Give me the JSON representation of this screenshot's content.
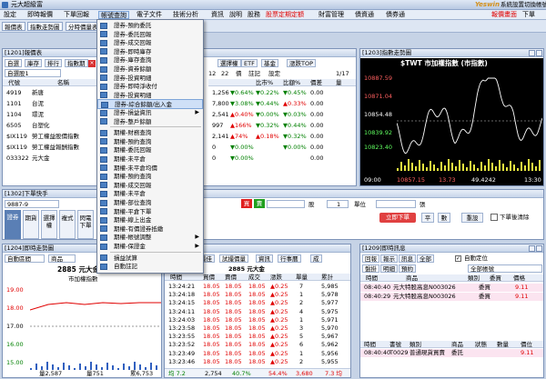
{
  "app": {
    "title": "元大超級富",
    "brand": "Yeswin",
    "sys_settings": "系統設置",
    "switch_account": "切換帳號",
    "right_buttons": [
      "報價畫面",
      "下單"
    ]
  },
  "menu": [
    "設定",
    "即時報價",
    "下單回報",
    "帳號查詢",
    "電子文件",
    "技術分析",
    "資訊",
    "說明",
    "股務",
    "股票定期定額",
    "財富管理",
    "債資通",
    "債券通"
  ],
  "toolbar": [
    "報價表",
    "指數走勢圖",
    "分時價量表"
  ],
  "quote_panel": {
    "title": "[1201]報價表",
    "tabs": [
      "自選",
      "庫存",
      "排行",
      "指數期",
      "個"
    ],
    "group_label": "自選股1",
    "col_code": "代號",
    "col_name": "名稱",
    "rows": [
      {
        "code": "4919",
        "name": "新唐"
      },
      {
        "code": "1101",
        "name": "台泥"
      },
      {
        "code": "1104",
        "name": "環泥"
      },
      {
        "code": "6505",
        "name": "台塑化"
      },
      {
        "code": "$IX119",
        "name": "勞工權益股價指數"
      },
      {
        "code": "$IX119",
        "name": "勞工權益報酬指數"
      },
      {
        "code": "033322",
        "name": "元大金"
      }
    ]
  },
  "quote_right": {
    "tabs": [
      "選擇權",
      "ETF",
      "基金",
      "漲跌TOP"
    ],
    "small_tabs": [
      "12",
      "22",
      "債",
      "註記",
      "設定"
    ],
    "page": "1/17",
    "headers": [
      "比市%",
      "比額%",
      "價差",
      "量"
    ],
    "rows": [
      {
        "v1": "1,256",
        "c1": "▼0.64%",
        "c2": "▼0.22%",
        "c3": "▼0.45%",
        "c4": "0.00"
      },
      {
        "v1": "7,800",
        "c1": "▼3.08%",
        "c2": "▼0.44%",
        "c3": "▲0.33%",
        "c4": "0.00"
      },
      {
        "v1": "2,541",
        "c1": "▲0.40%",
        "c2": "▼0.00%",
        "c3": "▼0.03%",
        "c4": "0.00"
      },
      {
        "v1": "997",
        "c1": "▲166%",
        "c2": "▼0.32%",
        "c3": "▼0.44%",
        "c4": "0.00"
      },
      {
        "v1": "2,141",
        "c1": "▲74%",
        "c2": "▲0.18%",
        "c3": "▼0.32%",
        "c4": "0.00"
      },
      {
        "v1": "0",
        "c1": "▼0.00%",
        "c2": "",
        "c3": "▼0.00%",
        "c4": "0.00"
      },
      {
        "v1": "0",
        "c1": "▼0.00%",
        "c2": "",
        "c3": "",
        "c4": "0.00"
      }
    ]
  },
  "dropdown": {
    "items": [
      "證券-預約委託",
      "證券-委託回報",
      "證券-成交回報",
      "證券-即時庫存",
      "證券-庫存查詢",
      "證券-資券餘額",
      "證券-投資明細",
      "證券-即時淨收付",
      "證券-投資明細",
      "證券-綜合餘額/出入金",
      "證券-損益資訊",
      "證券-整戶餘額",
      "期權-財務查詢",
      "期權-預約查詢",
      "期權-委託回報",
      "期權-未平倉",
      "期權-未平倉均價",
      "期權-預約查詢",
      "期權-成交回報",
      "期權-未平倉",
      "期權-部位查詢",
      "期權-平倉下單",
      "期權-線上出金",
      "期權-有價證券抵繳",
      "期權-帳號調整",
      "期權-保證金",
      "損益試算",
      "自動註記"
    ],
    "selected_index": 9,
    "has_submenu": [
      10,
      24,
      25
    ]
  },
  "index_panel": {
    "title": "[1203]指數走勢圖",
    "name": "$TWT 市加權指數 (市指數)",
    "price_labels": [
      "10887.59",
      "10871.04",
      "10854.48",
      "10839.92",
      "10823.40"
    ],
    "bottom_time_start": "09:00",
    "bottom_time_end": "13:30",
    "bottom_values": [
      "10857.15",
      "13.73",
      "49.4242"
    ],
    "time_labels": [
      "10:00",
      "12:00",
      "13:30"
    ]
  },
  "order_panel": {
    "title": "[1302]下單快手",
    "account": "9887-9",
    "buy": "買",
    "sell": "賣",
    "side_tabs": [
      "證券",
      "期貨",
      "選擇權",
      "複式",
      "閃電下單"
    ],
    "share_unit": "股",
    "qty": "1",
    "price_unit": "單位",
    "send_button": "立即下單",
    "row2": [
      "張",
      "平",
      "數"
    ],
    "clear": "重設",
    "confirm_check": "下單後清除"
  },
  "chart_panel": {
    "title": "[1204]即時走勢圖",
    "mode": "自動區間",
    "type": "商品",
    "stock": "2885 元大金",
    "subtitle": "市加權指數",
    "levels": [
      "19.00",
      "18.00",
      "17.00",
      "16.00",
      "15.00"
    ],
    "bottom": [
      "量2,587",
      "量751",
      "累6,753"
    ]
  },
  "tick_panel": {
    "title": "量表",
    "tabs": [
      "明",
      "最佳",
      "試撮價量",
      "資訊",
      "行事曆",
      "成"
    ],
    "stock": "2885 元大金",
    "headers": [
      "時間",
      "買價",
      "賣價",
      "成交",
      "漲跌",
      "單量",
      "累計"
    ],
    "rows": [
      {
        "t": "13:24:21",
        "b": "18.05",
        "s": "18.05",
        "p": "18.05",
        "c": "▲0.25",
        "q": "7",
        "a": "5,985"
      },
      {
        "t": "13:24:18",
        "b": "18.05",
        "s": "18.05",
        "p": "18.05",
        "c": "▲0.25",
        "q": "1",
        "a": "5,978"
      },
      {
        "t": "13:24:15",
        "b": "18.05",
        "s": "18.05",
        "p": "18.05",
        "c": "▲0.25",
        "q": "2",
        "a": "5,977"
      },
      {
        "t": "13:24:11",
        "b": "18.05",
        "s": "18.05",
        "p": "18.05",
        "c": "▲0.25",
        "q": "4",
        "a": "5,975"
      },
      {
        "t": "13:24:03",
        "b": "18.05",
        "s": "18.05",
        "p": "18.05",
        "c": "▲0.25",
        "q": "1",
        "a": "5,971"
      },
      {
        "t": "13:23:58",
        "b": "18.05",
        "s": "18.05",
        "p": "18.05",
        "c": "▲0.25",
        "q": "3",
        "a": "5,970"
      },
      {
        "t": "13:23:55",
        "b": "18.05",
        "s": "18.05",
        "p": "18.05",
        "c": "▲0.25",
        "q": "5",
        "a": "5,967"
      },
      {
        "t": "13:23:52",
        "b": "18.05",
        "s": "18.05",
        "p": "18.05",
        "c": "▲0.25",
        "q": "6",
        "a": "5,962"
      },
      {
        "t": "13:23:49",
        "b": "18.05",
        "s": "18.05",
        "p": "18.05",
        "c": "▲0.25",
        "q": "1",
        "a": "5,956"
      },
      {
        "t": "13:23:46",
        "b": "18.05",
        "s": "18.05",
        "p": "18.05",
        "c": "▲0.25",
        "q": "2",
        "a": "5,955"
      }
    ],
    "footer": [
      "均 7.2",
      "2,754",
      "40.7%",
      "54.4%",
      "3,680",
      "7.3 均"
    ]
  },
  "msg_panel": {
    "title": "[1209]即時訊息",
    "tabs": [
      "回報",
      "報示",
      "訊息",
      "全部"
    ],
    "auto_check": "自動定位",
    "sub_tabs": [
      "盤掛",
      "明細",
      "預約"
    ],
    "account_select": "全部帳號",
    "headers": [
      "時間",
      "商品",
      "類別",
      "委買",
      "價格"
    ],
    "rows": [
      {
        "t": "08:40:40",
        "n": "元大特股高息N003026",
        "k": "委買",
        "p": "9.11"
      },
      {
        "t": "08:40:29",
        "n": "元大特股高息N003026",
        "k": "委買",
        "p": "9.11"
      }
    ],
    "lower_headers": [
      "時間",
      "書號",
      "類別",
      "商品",
      "狀態",
      "數量",
      "價位"
    ],
    "lower_row": {
      "t": "08:40:40",
      "n": "T0029",
      "k": "普通現貨買賣",
      "p": "委託",
      "s": "",
      "q": "",
      "v": "9.11"
    }
  },
  "colors": {
    "up": "#e00000",
    "down": "#008000",
    "accent": "#0000c0"
  }
}
